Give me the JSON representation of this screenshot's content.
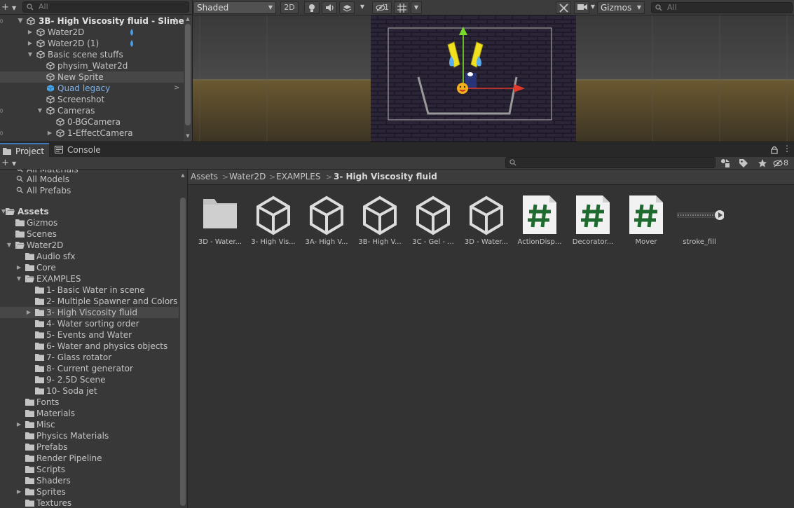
{
  "hierarchy": {
    "search_placeholder": "All",
    "rows": [
      {
        "label": "3B- High Viscosity fluid - Slime",
        "bold": true
      },
      {
        "label": "Water2D"
      },
      {
        "label": "Water2D (1)"
      },
      {
        "label": "Basic scene stuffs"
      },
      {
        "label": "physim_Water2d"
      },
      {
        "label": "New Sprite"
      },
      {
        "label": "Quad legacy"
      },
      {
        "label": "Screenshot"
      },
      {
        "label": "Cameras"
      },
      {
        "label": "0-BGCamera"
      },
      {
        "label": "1-EffectCamera"
      }
    ]
  },
  "scene": {
    "shading_mode": "Shaded",
    "mode_2d_label": "2D",
    "hidden_count": "1",
    "gizmos_label": "Gizmos",
    "search_placeholder": "All"
  },
  "project": {
    "tabs": [
      "Project",
      "Console"
    ],
    "hidden_count": "8",
    "tree": [
      {
        "label": "All Materials"
      },
      {
        "label": "All Models"
      },
      {
        "label": "All Prefabs"
      },
      {
        "label": "Assets"
      },
      {
        "label": "Gizmos"
      },
      {
        "label": "Scenes"
      },
      {
        "label": "Water2D"
      },
      {
        "label": "Audio sfx"
      },
      {
        "label": "Core"
      },
      {
        "label": "EXAMPLES"
      },
      {
        "label": "1- Basic Water in scene"
      },
      {
        "label": "2- Multiple Spawner and Colors"
      },
      {
        "label": "3- High Viscosity fluid"
      },
      {
        "label": "4- Water sorting order"
      },
      {
        "label": "5- Events and Water"
      },
      {
        "label": "6- Water and physics objects"
      },
      {
        "label": "7- Glass rotator"
      },
      {
        "label": "8- Current generator"
      },
      {
        "label": "9- 2.5D Scene"
      },
      {
        "label": "10- Soda jet"
      },
      {
        "label": "Fonts"
      },
      {
        "label": "Materials"
      },
      {
        "label": "Misc"
      },
      {
        "label": "Physics Materials"
      },
      {
        "label": "Prefabs"
      },
      {
        "label": "Render Pipeline"
      },
      {
        "label": "Scripts"
      },
      {
        "label": "Shaders"
      },
      {
        "label": "Sprites"
      },
      {
        "label": "Textures"
      }
    ],
    "breadcrumb": [
      "Assets",
      "Water2D",
      "EXAMPLES",
      "3- High Viscosity fluid"
    ],
    "assets": [
      {
        "name": "3D - Water...",
        "kind": "folder"
      },
      {
        "name": "3- High Vis...",
        "kind": "unity-scene"
      },
      {
        "name": "3A- High V...",
        "kind": "unity-scene"
      },
      {
        "name": "3B- High V...",
        "kind": "unity-scene"
      },
      {
        "name": "3C - Gel - ...",
        "kind": "unity-scene"
      },
      {
        "name": "3D - Water...",
        "kind": "unity-scene"
      },
      {
        "name": "ActionDisp...",
        "kind": "csharp-script"
      },
      {
        "name": "Decorator...",
        "kind": "csharp-script"
      },
      {
        "name": "Mover",
        "kind": "csharp-script"
      },
      {
        "name": "stroke_fill",
        "kind": "timeline"
      }
    ]
  }
}
